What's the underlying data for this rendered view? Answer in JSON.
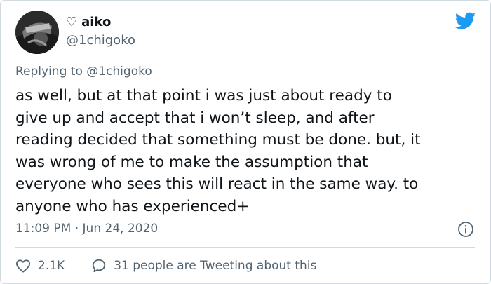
{
  "user": {
    "name_prefix": "♡",
    "display_name": "aiko",
    "handle": "@1chigoko"
  },
  "reply": {
    "prefix": "Replying to",
    "target": "@1chigoko"
  },
  "tweet": {
    "text": "as well, but at that point i was just about ready to\ngive up and accept that i won’t sleep, and after\nreading decided that something must be done. but, it\nwas wrong of me to make the assumption that\neveryone who sees this will react in the same way. to\nanyone who has experienced+",
    "time": "11:09 PM",
    "separator": "·",
    "date": "Jun 24, 2020"
  },
  "actions": {
    "likes": "2.1K",
    "conversation": "31 people are Tweeting about this"
  },
  "icons": {
    "brand": "twitter-bird-icon",
    "info": "info-icon",
    "like": "heart-icon",
    "reply": "speech-bubble-icon"
  },
  "colors": {
    "brand": "#1d9bf0",
    "text": "#0f1419",
    "secondary": "#536471",
    "border": "#cfd9de"
  }
}
